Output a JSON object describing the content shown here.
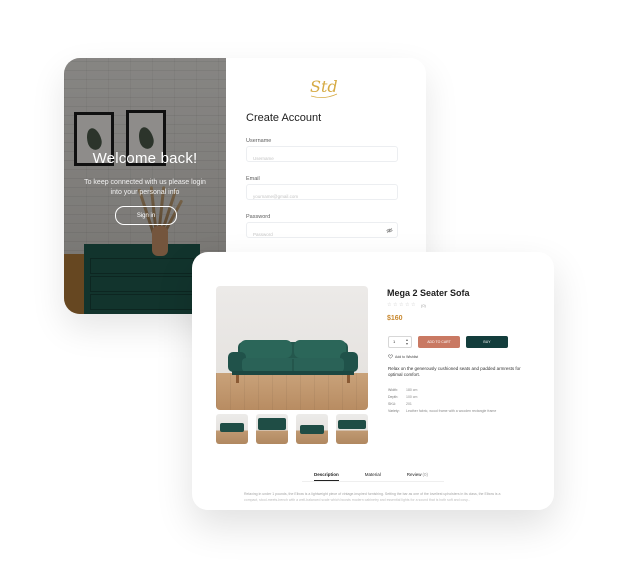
{
  "login": {
    "welcome_title": "Welcome back!",
    "welcome_text": "To keep connected with us please login into your personal info",
    "signin_label": "Sign in",
    "logo_text": "Std",
    "create_title": "Create Account",
    "username_label": "Username",
    "username_placeholder": "Username",
    "email_label": "Email",
    "email_placeholder": "yourname@gmail.com",
    "password_label": "Password",
    "password_placeholder": "Password"
  },
  "product": {
    "name": "Mega 2 Seater Sofa",
    "rating_count": "(0)",
    "price": "$160",
    "quantity": "1",
    "add_to_cart_label": "ADD TO CART",
    "buy_label": "BUY",
    "wishlist_label": "Add to Wishlist",
    "description": "Relax on the generously cushioned seats and padded armrests for optimal comfort.",
    "specs": [
      {
        "key": "Width:",
        "value": "180 cm"
      },
      {
        "key": "Depth:",
        "value": "100 cm"
      },
      {
        "key": "SKU:",
        "value": "201"
      },
      {
        "key": "Variety:",
        "value": "Leather fabric, wood frame with a wooden rectangle frame"
      }
    ],
    "tabs": [
      {
        "label": "Description",
        "count": ""
      },
      {
        "label": "Material",
        "count": ""
      },
      {
        "label": "Review",
        "count": "(0)"
      }
    ],
    "long_description": "Relaxing in under 1 pounds, the Elbow is a lightweight piece of vintage-inspired furnishing. Setting the bar as one of the loveliest upholsters in its class, the Elbow is a compact, stool-meets-bench with a well-balanced scale which boosts modern cabinetry and essential lights for a sound that is both soft and cosy..."
  },
  "colors": {
    "accent_gold": "#c8882f",
    "add_to_cart": "#c97963",
    "buy": "#133d3c",
    "sofa_green": "#1f4d45"
  }
}
